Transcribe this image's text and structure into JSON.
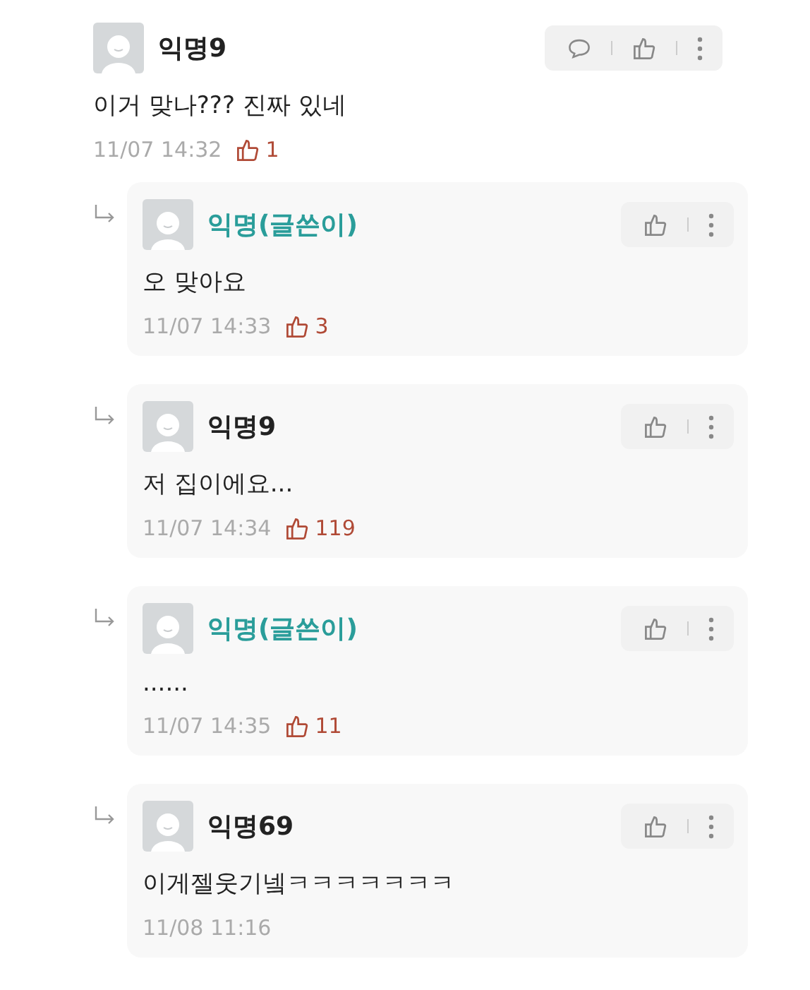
{
  "comments": [
    {
      "kind": "comment",
      "author": "익명9",
      "is_writer": false,
      "text": "이거 맞나??? 진짜 있네",
      "time": "11/07 14:32",
      "likes": "1"
    },
    {
      "kind": "reply",
      "author": "익명(글쓴이)",
      "is_writer": true,
      "text": "오 맞아요",
      "time": "11/07 14:33",
      "likes": "3"
    },
    {
      "kind": "reply",
      "author": "익명9",
      "is_writer": false,
      "text": "저 집이에요...",
      "time": "11/07 14:34",
      "likes": "119"
    },
    {
      "kind": "reply",
      "author": "익명(글쓴이)",
      "is_writer": true,
      "text": "......",
      "time": "11/07 14:35",
      "likes": "11"
    },
    {
      "kind": "reply",
      "author": "익명69",
      "is_writer": false,
      "text": "이게젤웃기넼ㅋㅋㅋㅋㅋㅋㅋ",
      "time": "11/08 11:16"
    }
  ]
}
